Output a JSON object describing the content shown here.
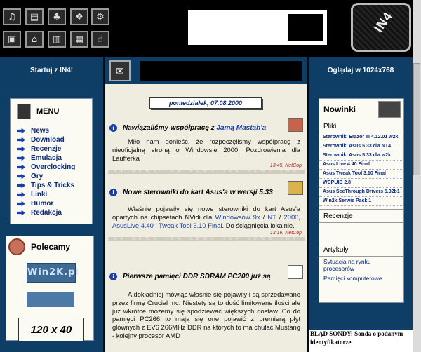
{
  "top_icons": [
    {
      "name": "audio-icon",
      "glyph": "♫"
    },
    {
      "name": "docs-icon",
      "glyph": "▤"
    },
    {
      "name": "games-icon",
      "glyph": "♣"
    },
    {
      "name": "windows-icon",
      "glyph": "❖"
    },
    {
      "name": "gear-icon",
      "glyph": "⚙"
    },
    {
      "name": "monitor-icon",
      "glyph": "▣"
    },
    {
      "name": "home-icon",
      "glyph": "⌂"
    },
    {
      "name": "book-icon",
      "glyph": "▥"
    },
    {
      "name": "notebook-icon",
      "glyph": "▦"
    },
    {
      "name": "hand-icon",
      "glyph": "☝"
    }
  ],
  "logo_text": "IN4",
  "header": {
    "left_label": "Startuj z IN4!",
    "right_label": "Oglądaj w 1024x768"
  },
  "menu": {
    "title": "MENU",
    "items": [
      "News",
      "Download",
      "Recenzje",
      "Emulacja",
      "Overclocking",
      "Gry",
      "Tips & Tricks",
      "Linki",
      "Humor",
      "Redakcja"
    ]
  },
  "polecamy": {
    "title": "Polecamy",
    "banner": "Win2K.pl",
    "ad_size": "120 x 40"
  },
  "date": "poniedziałek, 07.08.2000",
  "news": [
    {
      "title_pre": "Nawiązaliśmy współpracę z ",
      "title_link": "Jamą Mastah'a",
      "body": [
        {
          "t": "Miło nam donieść, że rozpoczęliśmy współpracę z nieoficjalną stroną o Windowsie 2000. Pozdrowienia dla Laufferka",
          "link": false
        }
      ],
      "meta": "13:45, NetCop"
    },
    {
      "title_pre": "Nowe sterowniki do kart Asus'a w wersji 5.33",
      "title_link": "",
      "body": [
        {
          "t": "Właśnie pojawiły się nowe sterowniki do kart Asus'a opartych na chipsetach NVidi dla ",
          "link": false
        },
        {
          "t": "Windowsów 9x",
          "link": true
        },
        {
          "t": " / ",
          "link": false
        },
        {
          "t": "NT",
          "link": true
        },
        {
          "t": " / ",
          "link": false
        },
        {
          "t": "2000",
          "link": true
        },
        {
          "t": ", ",
          "link": false
        },
        {
          "t": "AsusLive 4.40",
          "link": true
        },
        {
          "t": " i ",
          "link": false
        },
        {
          "t": "Tweak Tool 3.10 Final",
          "link": true
        },
        {
          "t": ". Do ściągnięcia lokalnie.",
          "link": false
        }
      ],
      "meta": "13:16, NetCop"
    },
    {
      "title_pre": "Pierwsze pamięci DDR SDRAM PC200 już są",
      "title_link": "",
      "body": [
        {
          "t": "A dokładniej mówiąc właśnie się pojawiły i są sprzedawane przez firmę Crucial Inc. Niestety są to dość limitowane ilości ale już wkrótce możemy się spodziewać większych dostaw. Co do pamięci PC266 to mają się one pojawić z premierą płyt głównych z EV6 266MHz DDR na których to ma chulać Mustang - kolejny procesor AMD",
          "link": false
        }
      ],
      "meta": ""
    }
  ],
  "divider_text": "IN4 NEWS  IN4 NEWS  IN4 NEWS  IN4 NEWS",
  "nowinki": {
    "title": "Nowinki",
    "pliki_label": "Pliki",
    "pliki": [
      "Sterowniki Erazor III 4.12.01 w2k",
      "Sterowniki Asus 5.33 dla NT4",
      "Sterowniki Asus 5.33 dla w2k",
      "Asus Live 4.40 Final",
      "Asus Tweak Tool 3.10 Final",
      "WCPUID 2.8",
      "Asus SeeThrough Drivers 5.32b1",
      "Win2k Serwis Pack 1"
    ],
    "recenzje_label": "Recenzje",
    "artykuly_label": "Artykuły",
    "artykuly": [
      "Sytuacja na rynku procesorów",
      "Pamięci komputerowe"
    ]
  },
  "sonda_error": "BŁĄD SONDY: Sonda o podanym identyfikatorze"
}
